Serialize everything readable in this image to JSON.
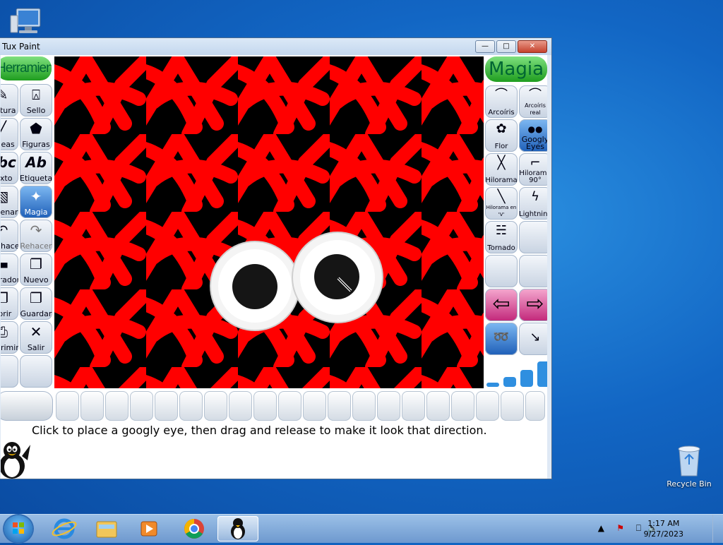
{
  "desktop": {
    "icons": [
      {
        "name": "computer",
        "label": ""
      },
      {
        "name": "recycle-bin",
        "label": "Recycle Bin"
      }
    ]
  },
  "window": {
    "title": "Tux Paint",
    "controls": {
      "minimize": "—",
      "maximize": "□",
      "close": "✕"
    }
  },
  "tools": {
    "header": "Herramientas",
    "items": [
      {
        "id": "paint",
        "label": "Pintura",
        "icon": "✎"
      },
      {
        "id": "stamp",
        "label": "Sello",
        "icon": "⍓"
      },
      {
        "id": "lines",
        "label": "Líneas",
        "icon": "╱"
      },
      {
        "id": "shapes",
        "label": "Figuras",
        "icon": "⬟"
      },
      {
        "id": "text",
        "label": "Texto",
        "icon": "abc"
      },
      {
        "id": "label",
        "label": "Etiqueta",
        "icon": "Ab"
      },
      {
        "id": "fill",
        "label": "Rellenar",
        "icon": "▧"
      },
      {
        "id": "magic",
        "label": "Magia",
        "icon": "✦",
        "selected": true
      },
      {
        "id": "undo",
        "label": "Deshacer",
        "icon": "↶"
      },
      {
        "id": "redo",
        "label": "Rehacer",
        "icon": "↷"
      },
      {
        "id": "eraser",
        "label": "Borrador",
        "icon": "▬"
      },
      {
        "id": "new",
        "label": "Nuevo",
        "icon": "❐"
      },
      {
        "id": "open",
        "label": "Abrir",
        "icon": "❐"
      },
      {
        "id": "save",
        "label": "Guardar",
        "icon": "❐"
      },
      {
        "id": "print",
        "label": "Imprimir",
        "icon": "⎙"
      },
      {
        "id": "quit",
        "label": "Salir",
        "icon": "✕"
      }
    ]
  },
  "magic": {
    "header": "Magia",
    "items": [
      {
        "id": "rainbow",
        "label": "Arcoíris",
        "icon": "⌒"
      },
      {
        "id": "real-rainbow",
        "label": "Arcoíris real",
        "icon": "⌒"
      },
      {
        "id": "flower",
        "label": "Flor",
        "icon": "✿"
      },
      {
        "id": "googly-eyes",
        "label": "Googly Eyes",
        "icon": "●●",
        "selected": true
      },
      {
        "id": "string-edges",
        "label": "Hilorama",
        "icon": "╳"
      },
      {
        "id": "string-corner",
        "label": "Hilorama 90°",
        "icon": "⌐"
      },
      {
        "id": "string-v",
        "label": "Hilorama en 'V'",
        "icon": "╲"
      },
      {
        "id": "lightning",
        "label": "Lightning",
        "icon": "ϟ"
      },
      {
        "id": "tornado",
        "label": "Tornado",
        "icon": "☵"
      }
    ],
    "prev_icon": "⇦",
    "next_icon": "⇨"
  },
  "status_message": "Click to place a googly eye, then drag and release to make it look that direction.",
  "taskbar": {
    "clock_time": "1:17 AM",
    "clock_date": "9/27/2023"
  },
  "colors": {
    "canvas_bg": "#000000",
    "stroke": "#ff0000",
    "accent_green": "#1f9d1f",
    "selected_blue": "#1e5fb8"
  }
}
